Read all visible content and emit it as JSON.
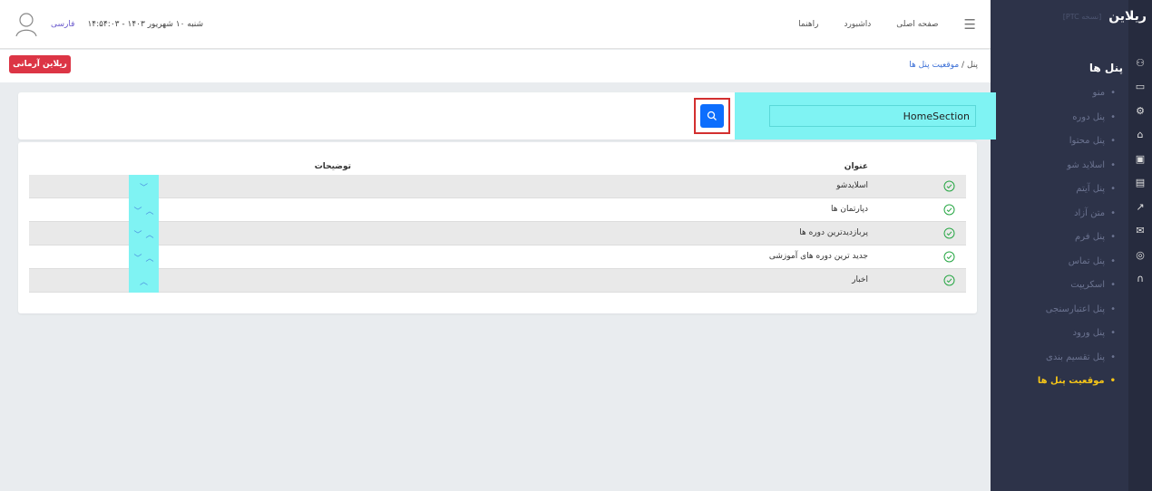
{
  "app": {
    "logo": "ریلاین",
    "version": "[نسخه PTC]"
  },
  "sidebar": {
    "title": "پنل ها",
    "items": [
      {
        "label": "منو",
        "active": false
      },
      {
        "label": "پنل دوره",
        "active": false
      },
      {
        "label": "پنل محتوا",
        "active": false
      },
      {
        "label": "اسلاید شو",
        "active": false
      },
      {
        "label": "پنل آیتم",
        "active": false
      },
      {
        "label": "متن آزاد",
        "active": false
      },
      {
        "label": "پنل فرم",
        "active": false
      },
      {
        "label": "پنل تماس",
        "active": false
      },
      {
        "label": "اسکریپت",
        "active": false
      },
      {
        "label": "پنل اعتبارسنجی",
        "active": false
      },
      {
        "label": "پنل ورود",
        "active": false
      },
      {
        "label": "پنل تقسیم بندی",
        "active": false
      },
      {
        "label": "موقعیت پنل ها",
        "active": true
      }
    ],
    "icons": [
      "users-icon",
      "monitor-icon",
      "settings-icon",
      "basket-icon",
      "gallery-icon",
      "image-icon",
      "chart-icon",
      "mail-icon",
      "chat-icon",
      "headset-icon"
    ]
  },
  "topbar": {
    "menu": [
      "صفحه اصلی",
      "داشبورد",
      "راهنما"
    ],
    "date": "شنبه ۱۰ شهریور ۱۴۰۳ - ۱۴:۵۴:۰۳",
    "language": "فارسی"
  },
  "breadcrumb": {
    "root": "پنل",
    "separator": "/",
    "current": "موقعیت پنل ها"
  },
  "brand_button": "ریلاین آرمانی",
  "search": {
    "value": "HomeSection"
  },
  "table": {
    "col_title": "عنوان",
    "col_desc": "توضیحات",
    "rows": [
      {
        "title": "اسلایدشو",
        "up": false,
        "down": true
      },
      {
        "title": "دپارتمان ها",
        "up": true,
        "down": true
      },
      {
        "title": "پربازدیدترین دوره ها",
        "up": true,
        "down": true
      },
      {
        "title": "جدید ترین دوره های آموزشی",
        "up": true,
        "down": true
      },
      {
        "title": "اخبار",
        "up": true,
        "down": false
      }
    ]
  },
  "colors": {
    "sidebar_bg": "#2d3349",
    "active_item": "#f5c518",
    "accent_blue": "#0d6efd",
    "highlight_cyan": "#7ff3f3",
    "danger": "#dc3545"
  }
}
